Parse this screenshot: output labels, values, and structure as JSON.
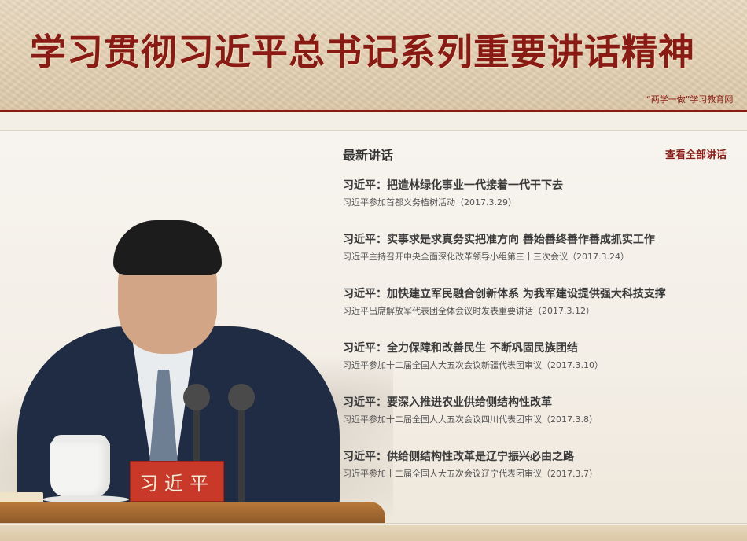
{
  "header": {
    "title": "学习贯彻习近平总书记系列重要讲话精神",
    "marquee": "“两学一做”学习教育网"
  },
  "portrait": {
    "nameplate": "习近平"
  },
  "news": {
    "section_title": "最新讲话",
    "more_link": "查看全部讲话",
    "items": [
      {
        "title": "习近平：把造林绿化事业一代接着一代干下去",
        "subtitle": "习近平参加首都义务植树活动（2017.3.29）"
      },
      {
        "title": "习近平：实事求是求真务实把准方向  善始善终善作善成抓实工作",
        "subtitle": "习近平主持召开中央全面深化改革领导小组第三十三次会议（2017.3.24）"
      },
      {
        "title": "习近平：加快建立军民融合创新体系  为我军建设提供强大科技支撑",
        "subtitle": "习近平出席解放军代表团全体会议时发表重要讲话（2017.3.12）"
      },
      {
        "title": "习近平：全力保障和改善民生  不断巩固民族团结",
        "subtitle": "习近平参加十二届全国人大五次会议新疆代表团审议（2017.3.10）"
      },
      {
        "title": "习近平：要深入推进农业供给侧结构性改革",
        "subtitle": "习近平参加十二届全国人大五次会议四川代表团审议（2017.3.8）"
      },
      {
        "title": "习近平：供给侧结构性改革是辽宁振兴必由之路",
        "subtitle": "习近平参加十二届全国人大五次会议辽宁代表团审议（2017.3.7）"
      }
    ]
  },
  "colors": {
    "brand_red": "#8a1a14",
    "banner_bg": "#e3d1b3",
    "text_dark": "#3a3a3a"
  }
}
